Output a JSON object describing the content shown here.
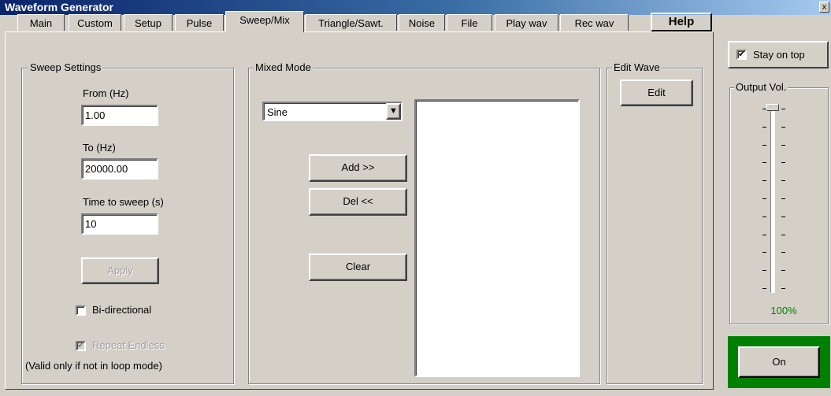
{
  "window": {
    "title": "Waveform Generator",
    "close_glyph": "x"
  },
  "tabs": [
    {
      "label": "Main"
    },
    {
      "label": "Custom"
    },
    {
      "label": "Setup"
    },
    {
      "label": "Pulse"
    },
    {
      "label": "Sweep/Mix"
    },
    {
      "label": "Triangle/Sawt."
    },
    {
      "label": "Noise"
    },
    {
      "label": "File"
    },
    {
      "label": "Play wav"
    },
    {
      "label": "Rec wav"
    }
  ],
  "active_tab": "Sweep/Mix",
  "help_label": "Help",
  "sweep": {
    "legend": "Sweep Settings",
    "from_label": "From (Hz)",
    "from_value": "1.00",
    "to_label": "To (Hz)",
    "to_value": "20000.00",
    "time_label": "Time to sweep (s)",
    "time_value": "10",
    "apply_label": "Apply",
    "bidirectional_label": "Bi-directional",
    "bidirectional_checked": false,
    "repeat_label": "Repeat Endless",
    "repeat_checked": true,
    "note": "(Valid only if not in loop mode)"
  },
  "mixed": {
    "legend": "Mixed Mode",
    "wave_selected": "Sine",
    "add_label": "Add >>",
    "del_label": "Del <<",
    "clear_label": "Clear"
  },
  "edit": {
    "legend": "Edit Wave",
    "edit_label": "Edit"
  },
  "side": {
    "stay_on_top_label": "Stay on top",
    "stay_on_top_checked": true,
    "output_legend": "Output Vol.",
    "volume_text": "100%",
    "volume_level": 1.0,
    "volume_color": "#008000",
    "on_label": "On",
    "on_frame_color": "#008000"
  },
  "check_glyph": "✔",
  "dropdown_glyph": "▼"
}
